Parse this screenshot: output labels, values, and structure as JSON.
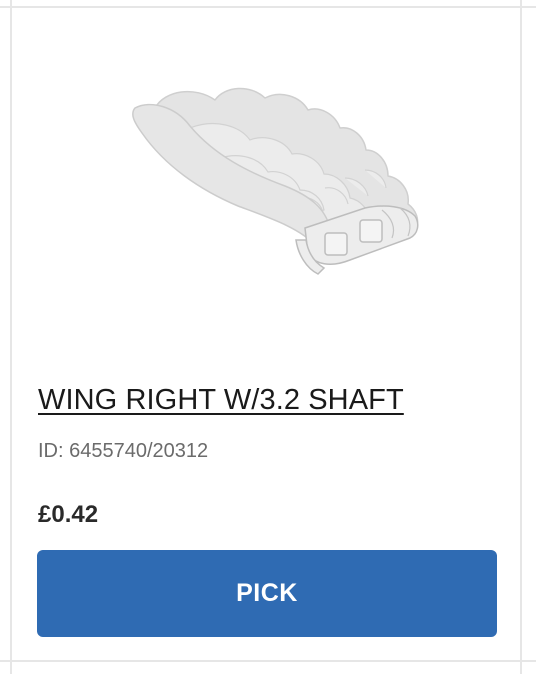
{
  "product": {
    "image_alt": "wing-right-part-image",
    "title": "WING RIGHT W/3.2 SHAFT",
    "id_text": "ID: 6455740/20312",
    "price": "£0.42",
    "button_label": "PICK"
  },
  "colors": {
    "button_bg": "#2f6bb3",
    "button_text": "#ffffff",
    "title_text": "#1a1a1a",
    "id_text": "#6b6b6b",
    "border": "#e6e6e6",
    "part_grey": "#e2e2e2"
  }
}
